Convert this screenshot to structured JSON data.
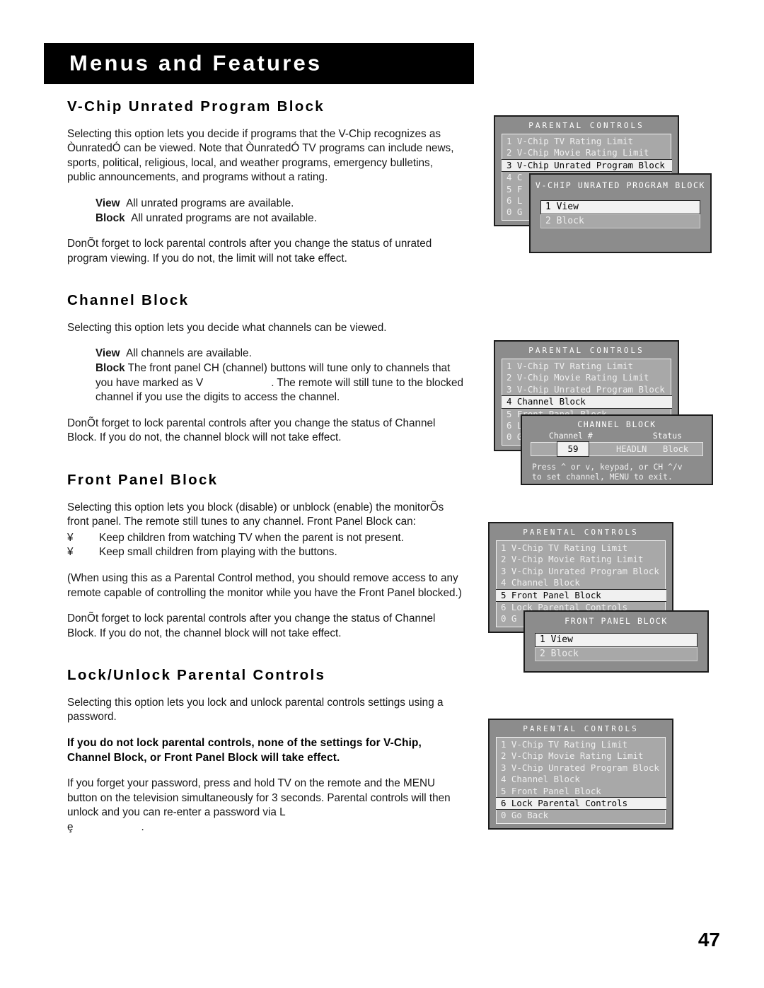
{
  "banner": {
    "title": "Menus and Features"
  },
  "page_number": "47",
  "sections": [
    {
      "heading": "V-Chip Unrated Program Block",
      "intro": "Selecting this option lets you decide if programs that the V-Chip recognizes as ÒunratedÓ can be viewed. Note that ÒunratedÓ TV programs can include news, sports, political, religious, local, and weather programs, emergency bulletins, public announcements, and programs without a rating.",
      "defs": [
        {
          "term": "View",
          "desc": "All unrated programs are available."
        },
        {
          "term": "Block",
          "desc": "All unrated programs are not available."
        }
      ],
      "closing": "DonÕt forget to lock parental controls after you change the status of unrated program viewing. If you do not, the limit will not take effect."
    },
    {
      "heading": "Channel Block",
      "intro": "Selecting this option lets you decide what channels can be viewed.",
      "defs": [
        {
          "term": "View",
          "desc": "All channels are available."
        },
        {
          "term": "Block",
          "desc": "The front panel CH (channel) buttons will tune only to channels that you have marked as V"
        },
        {
          "term": "",
          "desc": ". The remote will still tune to the blocked channel if you use the digits to access the channel."
        }
      ],
      "closing": "DonÕt forget to lock parental controls after you change the status of Channel Block. If you do not, the channel block will not take effect."
    },
    {
      "heading": "Front Panel Block",
      "intro": "Selecting this option lets you block (disable) or unblock (enable) the monitorÕs front panel. The remote still tunes to any channel. Front Panel Block can:",
      "bullet_char": "¥",
      "bullets": [
        "Keep children from watching TV when the parent is not present.",
        "Keep small children from playing with the buttons."
      ],
      "note": "(When using this as a Parental Control method, you should remove access to any remote capable of controlling the monitor while you have the Front Panel blocked.)",
      "closing": "DonÕt forget to lock parental controls after you change the status of Channel Block. If you do not, the channel block will not take effect."
    },
    {
      "heading": "Lock/Unlock Parental Controls",
      "intro": "Selecting this option lets you lock and unlock parental controls settings using a password.",
      "bold_warning": "If you do not lock parental controls, none of the settings for V-Chip, Channel Block, or Front Panel Block will take effect.",
      "closing": "If you forget your password, press and hold TV on the remote and the MENU button on the television simultaneously for 3 seconds. Parental controls will then unlock and you can re-enter a password via L",
      "tail_glyph": "ȩ",
      "tail_period": "."
    }
  ],
  "osd": {
    "parental_title": "PARENTAL CONTROLS",
    "menu_items": [
      "1 V-Chip TV Rating Limit",
      "2 V-Chip Movie Rating Limit",
      "3 V-Chip Unrated Program Block",
      "4 Channel Block",
      "5 Front Panel Block",
      "6 Lock Parental Controls",
      "0 Go Back"
    ],
    "short_items": [
      "1 V",
      "2 V",
      "3 V",
      "4 C",
      "5 F",
      "6 L",
      "0 G"
    ],
    "graphic1": {
      "selected_index": 2,
      "dialog_title": "V-CHIP UNRATED PROGRAM BLOCK",
      "options": [
        {
          "label": "1 View",
          "selected": true
        },
        {
          "label": "2 Block",
          "selected": false
        }
      ]
    },
    "graphic2": {
      "selected_index": 3,
      "dialog_title": "CHANNEL BLOCK",
      "col_channel": "Channel #",
      "col_status": "Status",
      "channel_value": "59",
      "channel_name": "HEADLN",
      "channel_status": "Block",
      "help_line1": "Press ^ or v, keypad, or CH ^/v",
      "help_line2": "to set channel, MENU to exit."
    },
    "graphic3": {
      "selected_index": 4,
      "dialog_title": "FRONT PANEL BLOCK",
      "options": [
        {
          "label": "1 View",
          "selected": true
        },
        {
          "label": "2 Block",
          "selected": false
        }
      ]
    },
    "graphic4": {
      "selected_index": 5
    }
  }
}
